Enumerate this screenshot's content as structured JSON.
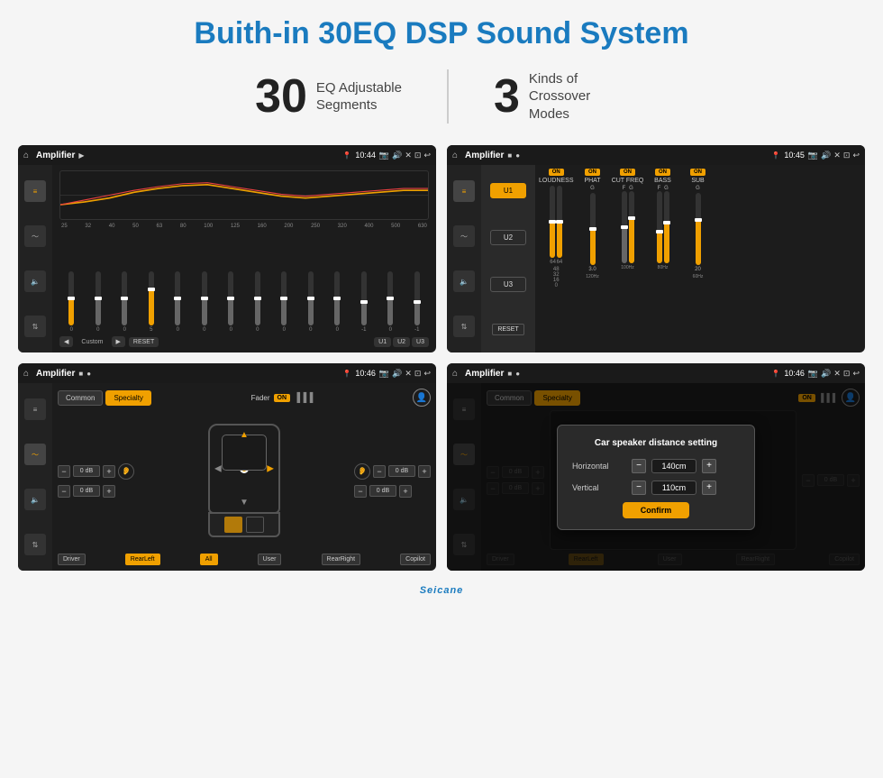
{
  "page": {
    "title": "Buith-in 30EQ DSP Sound System",
    "stats": [
      {
        "number": "30",
        "label": "EQ Adjustable\nSegments"
      },
      {
        "number": "3",
        "label": "Kinds of\nCrossover Modes"
      }
    ],
    "watermark": "Seicane"
  },
  "screen1": {
    "title": "Amplifier",
    "time": "10:44",
    "mode": "Custom",
    "reset_label": "RESET",
    "u1_label": "U1",
    "u2_label": "U2",
    "u3_label": "U3",
    "freq_labels": [
      "25",
      "32",
      "40",
      "50",
      "63",
      "80",
      "100",
      "125",
      "160",
      "200",
      "250",
      "320",
      "400",
      "500",
      "630"
    ],
    "slider_values": [
      "0",
      "0",
      "0",
      "5",
      "0",
      "0",
      "0",
      "0",
      "0",
      "0",
      "0",
      "-1",
      "0",
      "-1"
    ]
  },
  "screen2": {
    "title": "Amplifier",
    "time": "10:45",
    "u1_label": "U1",
    "u2_label": "U2",
    "u3_label": "U3",
    "reset_label": "RESET",
    "cols": [
      {
        "label": "LOUDNESS",
        "on": true
      },
      {
        "label": "PHAT",
        "on": true
      },
      {
        "label": "CUT FREQ",
        "on": true
      },
      {
        "label": "BASS",
        "on": true
      },
      {
        "label": "SUB",
        "on": true
      }
    ]
  },
  "screen3": {
    "title": "Amplifier",
    "time": "10:46",
    "common_label": "Common",
    "specialty_label": "Specialty",
    "fader_label": "Fader",
    "on_label": "ON",
    "db_values": [
      "0 dB",
      "0 dB",
      "0 dB",
      "0 dB"
    ],
    "bottom_buttons": [
      "Driver",
      "RearLeft",
      "All",
      "User",
      "RearRight",
      "Copilot"
    ]
  },
  "screen4": {
    "title": "Amplifier",
    "time": "10:46",
    "common_label": "Common",
    "specialty_label": "Specialty",
    "modal_title": "Car speaker distance setting",
    "horizontal_label": "Horizontal",
    "horizontal_value": "140cm",
    "vertical_label": "Vertical",
    "vertical_value": "110cm",
    "confirm_label": "Confirm",
    "db_values": [
      "0 dB",
      "0 dB"
    ],
    "bottom_buttons": [
      "Driver",
      "RearLeft",
      "User",
      "RearRight",
      "Copilot"
    ]
  }
}
